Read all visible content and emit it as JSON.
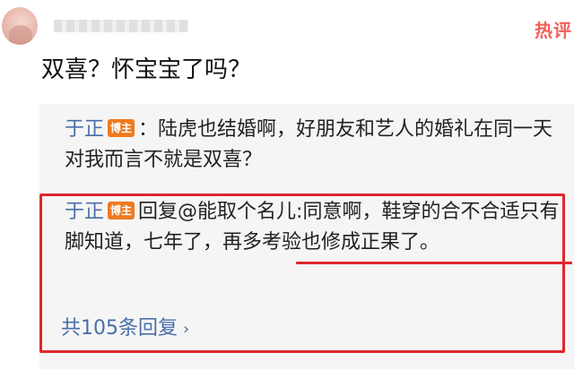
{
  "comment": {
    "hot_label": "热评",
    "text": "双喜？怀宝宝了吗？"
  },
  "replies": [
    {
      "author": "于正",
      "badge": "博主",
      "separator": "：",
      "text": "陆虎也结婚啊，好朋友和艺人的婚礼在同一天对我而言不就是双喜？"
    },
    {
      "author": "于正",
      "badge": "博主",
      "reply_prefix": "回复@能取个名儿:",
      "text": "同意啊，鞋穿的合不合适只有脚知道，七年了，再多考验也修成正果了。"
    }
  ],
  "more_replies": {
    "label": "共105条回复",
    "icon": "chevron-right-icon"
  },
  "colors": {
    "author": "#4a6ea9",
    "badge": "#f07a1e",
    "highlight": "#e0262f",
    "hot": "#f2605a",
    "reply_bg": "#f5f5f5"
  }
}
